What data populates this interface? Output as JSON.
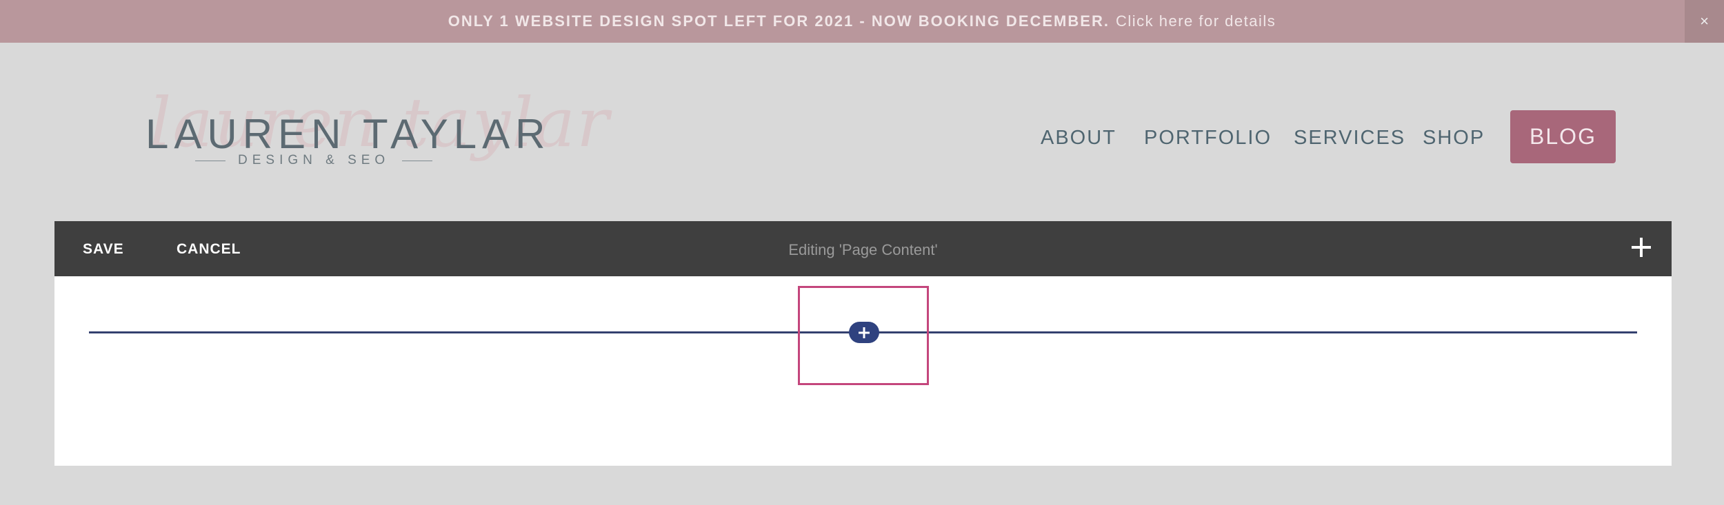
{
  "announcement": {
    "bold_text": "ONLY 1 WEBSITE DESIGN SPOT LEFT FOR 2021 - NOW BOOKING DECEMBER.",
    "link_text": "Click here for details",
    "close_glyph": "×"
  },
  "logo": {
    "script_text": "lauren taylar",
    "name": "LAUREN TAYLAR",
    "tagline": "DESIGN & SEO"
  },
  "nav": {
    "items": [
      {
        "label": "ABOUT"
      },
      {
        "label": "PORTFOLIO"
      },
      {
        "label": "SERVICES"
      },
      {
        "label": "SHOP"
      }
    ],
    "cta_label": "BLOG"
  },
  "editor": {
    "save_label": "SAVE",
    "cancel_label": "CANCEL",
    "title": "Editing 'Page Content'",
    "add_icon": "plus-icon",
    "insert_icon": "plus-icon"
  },
  "colors": {
    "announce_bg": "#b9979c",
    "accent": "#a8677a",
    "toolbar_bg": "#3f3f3f",
    "insert_blue": "#2f427f",
    "highlight": "#c4467c"
  }
}
